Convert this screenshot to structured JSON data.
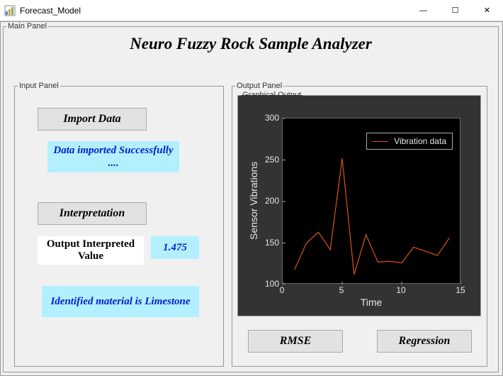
{
  "window": {
    "title": "Forecast_Model",
    "min_label": "—",
    "max_label": "☐",
    "close_label": "✕"
  },
  "main": {
    "legend": "Main Panel",
    "app_title": "Neuro Fuzzy Rock Sample Analyzer"
  },
  "input": {
    "legend": "Input Panel",
    "import_label": "Import Data",
    "import_msg": "Data imported Successfully ....",
    "interp_label": "Interpretation",
    "oiv_label": "Output Interpreted Value",
    "oiv_value": "1.475",
    "material_msg": "Identified material is Limestone"
  },
  "output": {
    "legend": "Output Panel",
    "graphical_legend": "Graphical Output",
    "rmse_label": "RMSE",
    "regression_label": "Regression"
  },
  "chart_data": {
    "type": "line",
    "title": "",
    "xlabel": "Time",
    "ylabel": "Sensor Vibrations",
    "xlim": [
      0,
      15
    ],
    "ylim": [
      100,
      300
    ],
    "xticks": [
      0,
      5,
      10,
      15
    ],
    "yticks": [
      100,
      150,
      200,
      250,
      300
    ],
    "series": [
      {
        "name": "Vibration data",
        "color": "#d95319",
        "x": [
          1,
          2,
          3,
          4,
          5,
          6,
          7,
          8,
          9,
          10,
          11,
          12,
          13,
          14
        ],
        "values": [
          118,
          150,
          163,
          142,
          252,
          112,
          160,
          127,
          128,
          126,
          145,
          140,
          135,
          156
        ]
      }
    ]
  }
}
